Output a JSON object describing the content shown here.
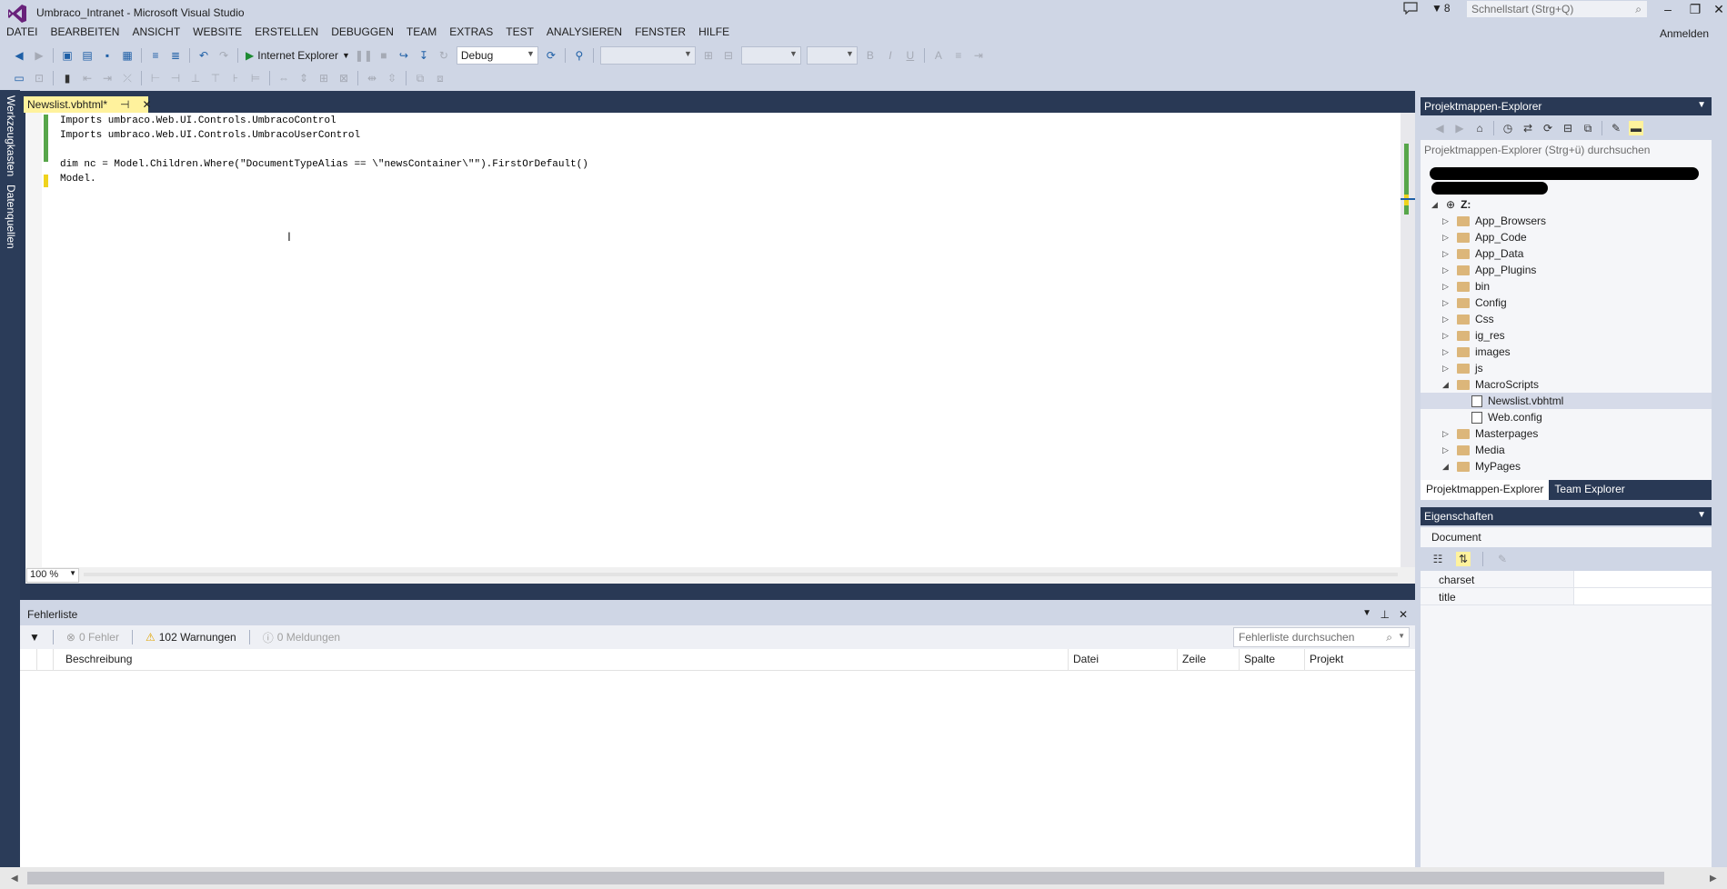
{
  "window": {
    "title": "Umbraco_Intranet - Microsoft Visual Studio",
    "notification_count": "8",
    "quicklaunch_placeholder": "Schnellstart (Strg+Q)",
    "signin_label": "Anmelden"
  },
  "menu": [
    "DATEI",
    "BEARBEITEN",
    "ANSICHT",
    "WEBSITE",
    "ERSTELLEN",
    "DEBUGGEN",
    "TEAM",
    "EXTRAS",
    "TEST",
    "ANALYSIEREN",
    "FENSTER",
    "HILFE"
  ],
  "toolbar": {
    "run_label": "Internet Explorer",
    "config_value": "Debug"
  },
  "siderail": [
    "Werkzeugkasten",
    "Datenquellen"
  ],
  "editor": {
    "tab_label": "Newslist.vbhtml*",
    "lines": [
      "Imports umbraco.Web.UI.Controls.UmbracoControl",
      "Imports umbraco.Web.UI.Controls.UmbracoUserControl",
      "",
      "dim nc = Model.Children.Where(\"DocumentTypeAlias == \\\"newsContainer\\\"\").FirstOrDefault()",
      "Model."
    ],
    "zoom": "100 %"
  },
  "errorlist": {
    "title": "Fehlerliste",
    "errors_label": "0 Fehler",
    "warnings_label": "102 Warnungen",
    "messages_label": "0 Meldungen",
    "search_placeholder": "Fehlerliste durchsuchen",
    "columns": [
      "Beschreibung",
      "Datei",
      "Zeile",
      "Spalte",
      "Projekt"
    ]
  },
  "solution_explorer": {
    "title": "Projektmappen-Explorer",
    "search_placeholder": "Projektmappen-Explorer (Strg+ü) durchsuchen",
    "root": "Z:",
    "items": [
      {
        "label": "App_Browsers",
        "type": "folder",
        "expanded": false
      },
      {
        "label": "App_Code",
        "type": "folder",
        "expanded": false
      },
      {
        "label": "App_Data",
        "type": "folder",
        "expanded": false
      },
      {
        "label": "App_Plugins",
        "type": "folder",
        "expanded": false
      },
      {
        "label": "bin",
        "type": "folder",
        "expanded": false
      },
      {
        "label": "Config",
        "type": "folder",
        "expanded": false
      },
      {
        "label": "Css",
        "type": "folder",
        "expanded": false
      },
      {
        "label": "ig_res",
        "type": "folder",
        "expanded": false
      },
      {
        "label": "images",
        "type": "folder",
        "expanded": false
      },
      {
        "label": "js",
        "type": "folder",
        "expanded": false
      },
      {
        "label": "MacroScripts",
        "type": "folder",
        "expanded": true
      },
      {
        "label": "Newslist.vbhtml",
        "type": "file",
        "selected": true
      },
      {
        "label": "Web.config",
        "type": "file"
      },
      {
        "label": "Masterpages",
        "type": "folder",
        "expanded": false
      },
      {
        "label": "Media",
        "type": "folder",
        "expanded": false
      },
      {
        "label": "MyPages",
        "type": "folder",
        "expanded": true
      }
    ],
    "tabs": [
      "Projektmappen-Explorer",
      "Team Explorer"
    ]
  },
  "properties": {
    "title": "Eigenschaften",
    "object": "Document",
    "rows": [
      {
        "name": "charset"
      },
      {
        "name": "title"
      }
    ]
  },
  "colors": {
    "frame": "#293955",
    "chrome": "#cfd6e5",
    "active_tab": "#fff29d",
    "change_saved": "#57a64a",
    "change_unsaved": "#efd31d"
  }
}
